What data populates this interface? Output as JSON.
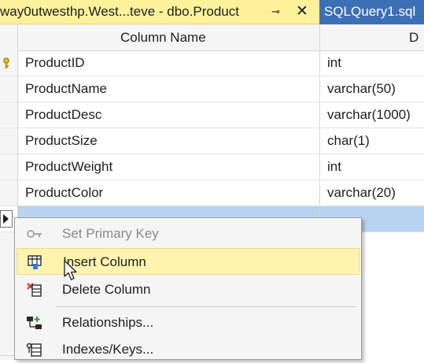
{
  "tabs": {
    "active": {
      "title": "way0utwesthp.West...teve - dbo.Product",
      "pin_glyph": "⊸",
      "close_glyph": "✕"
    },
    "inactive": {
      "title": "SQLQuery1.sql"
    }
  },
  "grid": {
    "headers": {
      "column_name": "Column Name",
      "data_type": "D"
    },
    "rows": [
      {
        "name": "ProductID",
        "type": "int",
        "primary_key": true
      },
      {
        "name": "ProductName",
        "type": "varchar(50)"
      },
      {
        "name": "ProductDesc",
        "type": "varchar(1000)"
      },
      {
        "name": "ProductSize",
        "type": "char(1)"
      },
      {
        "name": "ProductWeight",
        "type": "int"
      },
      {
        "name": "ProductColor",
        "type": "varchar(20)"
      },
      {
        "name": "",
        "type": "",
        "selected": true
      }
    ]
  },
  "context_menu": {
    "items": [
      {
        "label": "Set Primary Key",
        "icon": "key-icon",
        "enabled": false
      },
      {
        "label": "Insert Column",
        "icon": "insert-column-icon",
        "enabled": true,
        "hover": true
      },
      {
        "label": "Delete Column",
        "icon": "delete-column-icon",
        "enabled": true
      },
      {
        "label": "Relationships...",
        "icon": "relationships-icon",
        "enabled": true
      },
      {
        "label": "Indexes/Keys...",
        "icon": "indexes-keys-icon",
        "enabled": true
      }
    ]
  },
  "colors": {
    "active_tab": "#fff29d",
    "inactive_tab": "#3d6fb6",
    "selected_row": "#b8d3f0",
    "menu_hover": "#fff3b0"
  }
}
